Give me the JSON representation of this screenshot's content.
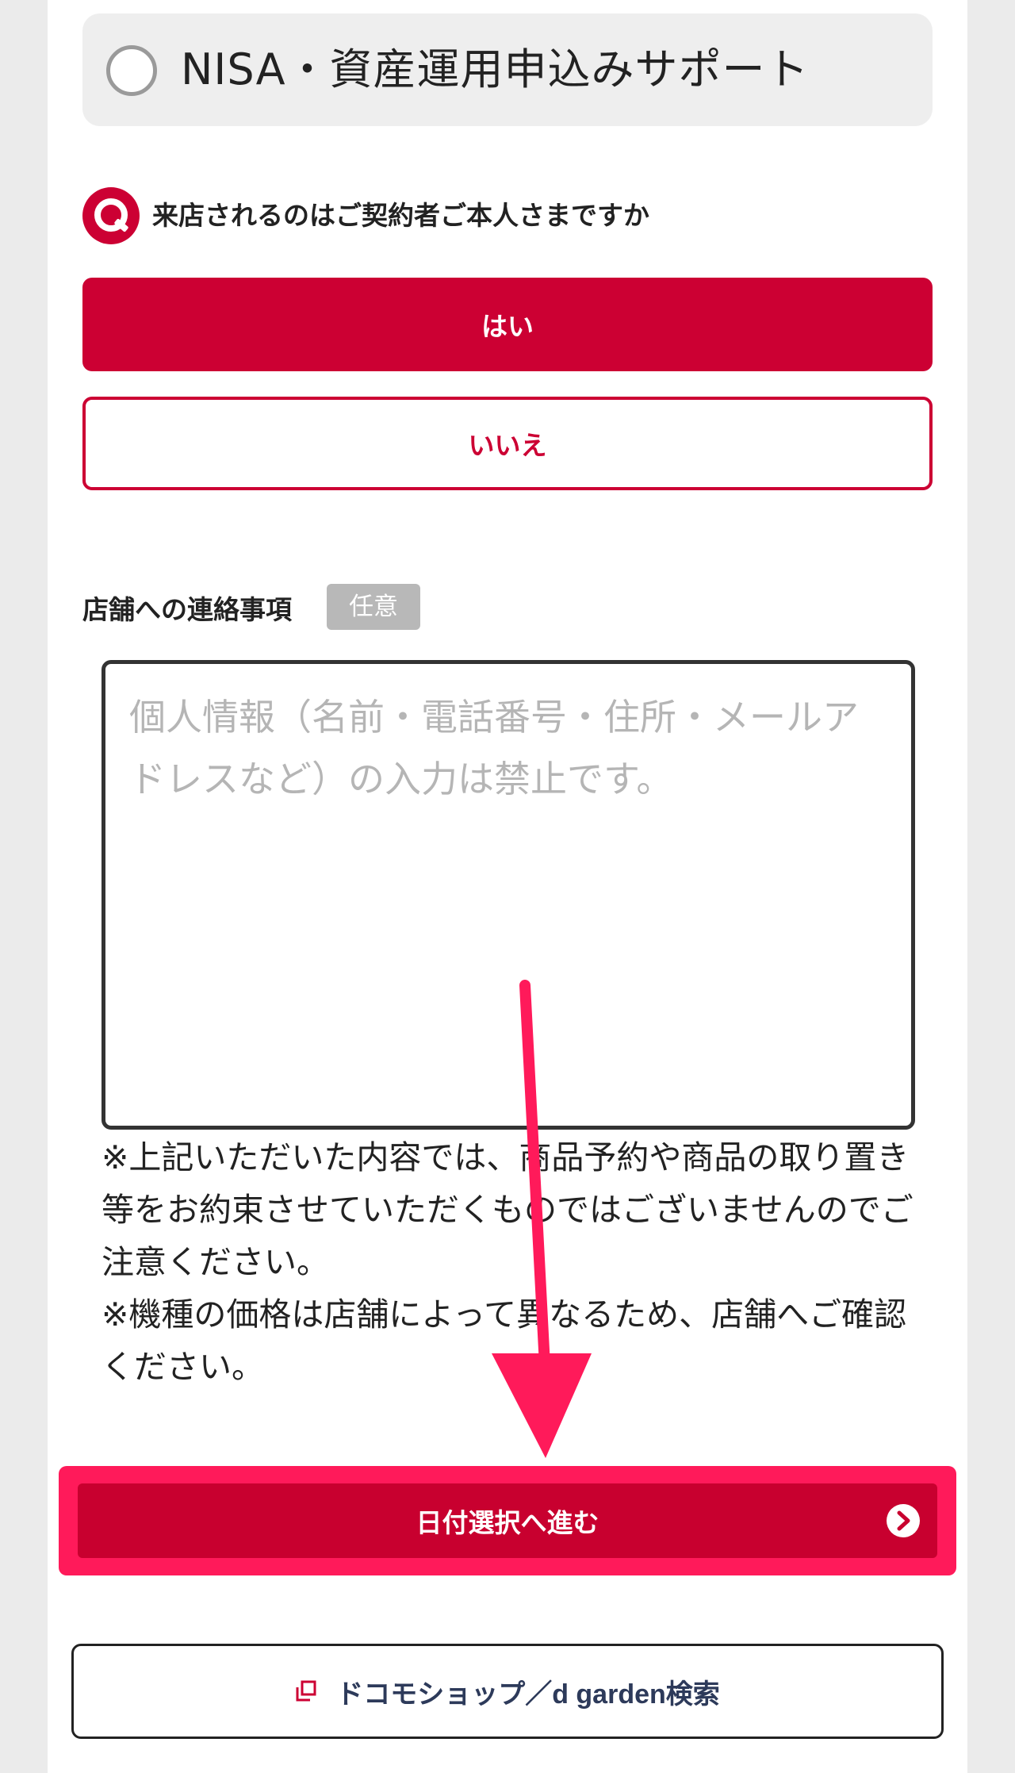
{
  "option": {
    "label": "NISA・資産運用申込みサポート",
    "selected": false
  },
  "question": {
    "badge": "Q",
    "text": "来店されるのはご契約者ご本人さまですか",
    "yes_label": "はい",
    "no_label": "いいえ",
    "selected": "はい"
  },
  "notes": {
    "label": "店舗への連絡事項",
    "badge": "任意",
    "placeholder": "個人情報（名前・電話番号・住所・メールアドレスなど）の入力は禁止です。",
    "value": ""
  },
  "disclaimer": [
    "※上記いただいた内容では、商品予約や商品の取り置き等をお約束させていただくものではございませんのでご注意ください。",
    "※機種の価格は店舗によって異なるため、店舗へご確認ください。"
  ],
  "proceed_label": "日付選択へ進む",
  "shop_search_label": "ドコモショップ／d garden検索",
  "colors": {
    "brand_red": "#cc0033",
    "highlight_pink": "#ff1a5a",
    "annotation_arrow": "#ff1a5a"
  }
}
